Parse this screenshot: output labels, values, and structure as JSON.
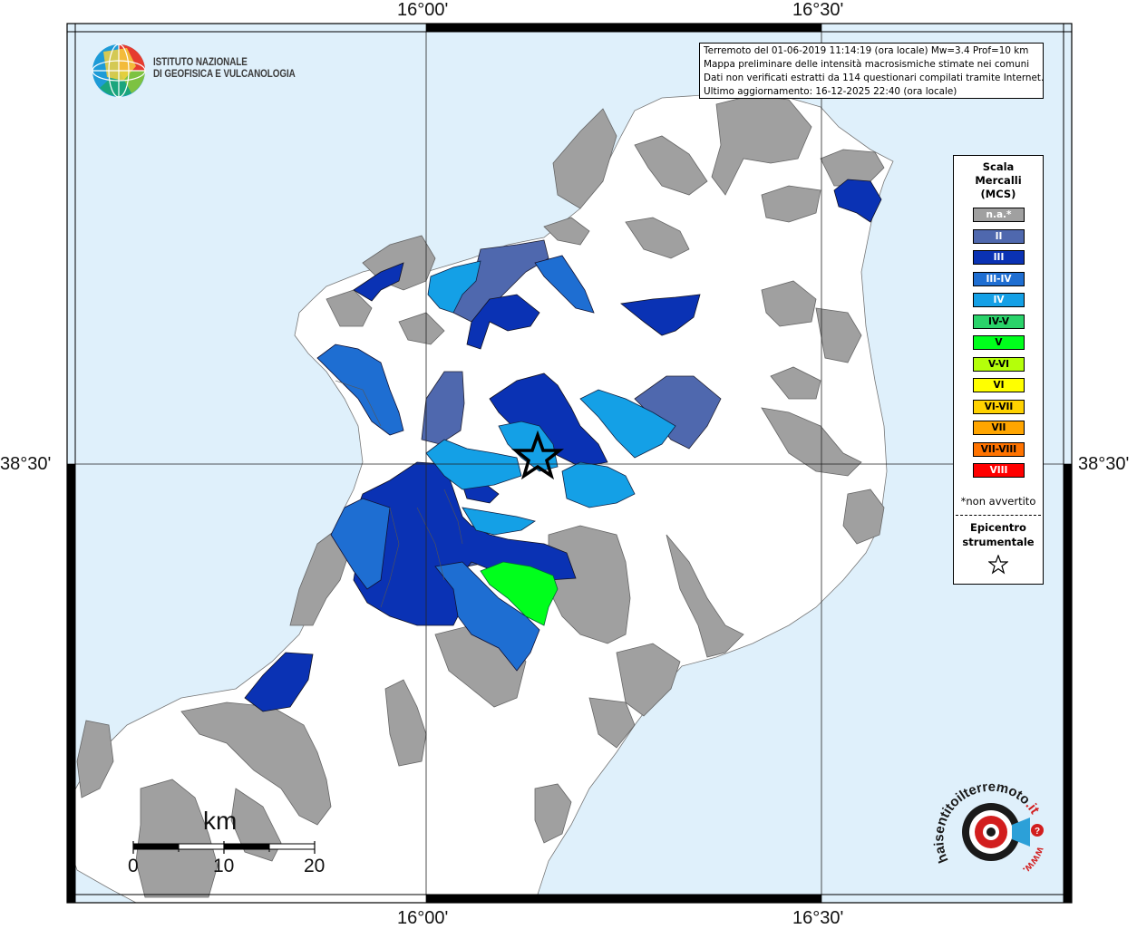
{
  "map": {
    "latitude_labels": [
      "38°30'",
      "38°30'"
    ],
    "longitude_labels_top": [
      "16°00'",
      "16°30'"
    ],
    "longitude_labels_bottom": [
      "16°00'",
      "16°30'"
    ],
    "colors": {
      "sea": "#dff0fb",
      "land": "#ffffff",
      "not_available": "#a0a0a0",
      "II": "#4f68ae",
      "III": "#0a32b4",
      "III-IV": "#1e6ed2",
      "IV": "#14a0e6",
      "IV-V": "#2ad36a",
      "V": "#00ff1c"
    }
  },
  "info": {
    "line1": "Terremoto del 01-06-2019 11:14:19 (ora locale) Mw=3.4 Prof=10 km",
    "line2": "Mappa preliminare delle intensità macrosismiche stimate nei comuni",
    "line3": "Dati non verificati estratti da 114 questionari compilati tramite Internet.",
    "line4": "Ultimo aggiornamento: 16-12-2025 22:40 (ora locale)"
  },
  "legend": {
    "title_line1": "Scala",
    "title_line2": "Mercalli",
    "title_line3": "(MCS)",
    "items": [
      {
        "label": "n.a.*",
        "color": "#a0a0a0",
        "text_color": "#ffffff"
      },
      {
        "label": "II",
        "color": "#4f68ae",
        "text_color": "#ffffff"
      },
      {
        "label": "III",
        "color": "#0a32b4",
        "text_color": "#ffffff"
      },
      {
        "label": "III-IV",
        "color": "#1e6ed2",
        "text_color": "#ffffff"
      },
      {
        "label": "IV",
        "color": "#14a0e6",
        "text_color": "#ffffff"
      },
      {
        "label": "IV-V",
        "color": "#2ad36a",
        "text_color": "#000000"
      },
      {
        "label": "V",
        "color": "#00ff1c",
        "text_color": "#000000"
      },
      {
        "label": "V-VI",
        "color": "#b4ff0a",
        "text_color": "#000000"
      },
      {
        "label": "VI",
        "color": "#ffff00",
        "text_color": "#000000"
      },
      {
        "label": "VI-VII",
        "color": "#ffd200",
        "text_color": "#000000"
      },
      {
        "label": "VII",
        "color": "#ffa500",
        "text_color": "#000000"
      },
      {
        "label": "VII-VIII",
        "color": "#ff7300",
        "text_color": "#000000"
      },
      {
        "label": "VIII",
        "color": "#ff0000",
        "text_color": "#ffffff"
      }
    ],
    "note": "*non avvertito",
    "epicenter_line1": "Epicentro",
    "epicenter_line2": "strumentale"
  },
  "logo": {
    "line1": "ISTITUTO NAZIONALE",
    "line2": "DI GEOFISICA E VULCANOLOGIA"
  },
  "scale": {
    "title": "km",
    "labels": [
      "0",
      "10",
      "20"
    ]
  },
  "hs_logo": {
    "text_main": "haisentitoilterremoto",
    "text_ext": ".it",
    "text_www": "www."
  }
}
